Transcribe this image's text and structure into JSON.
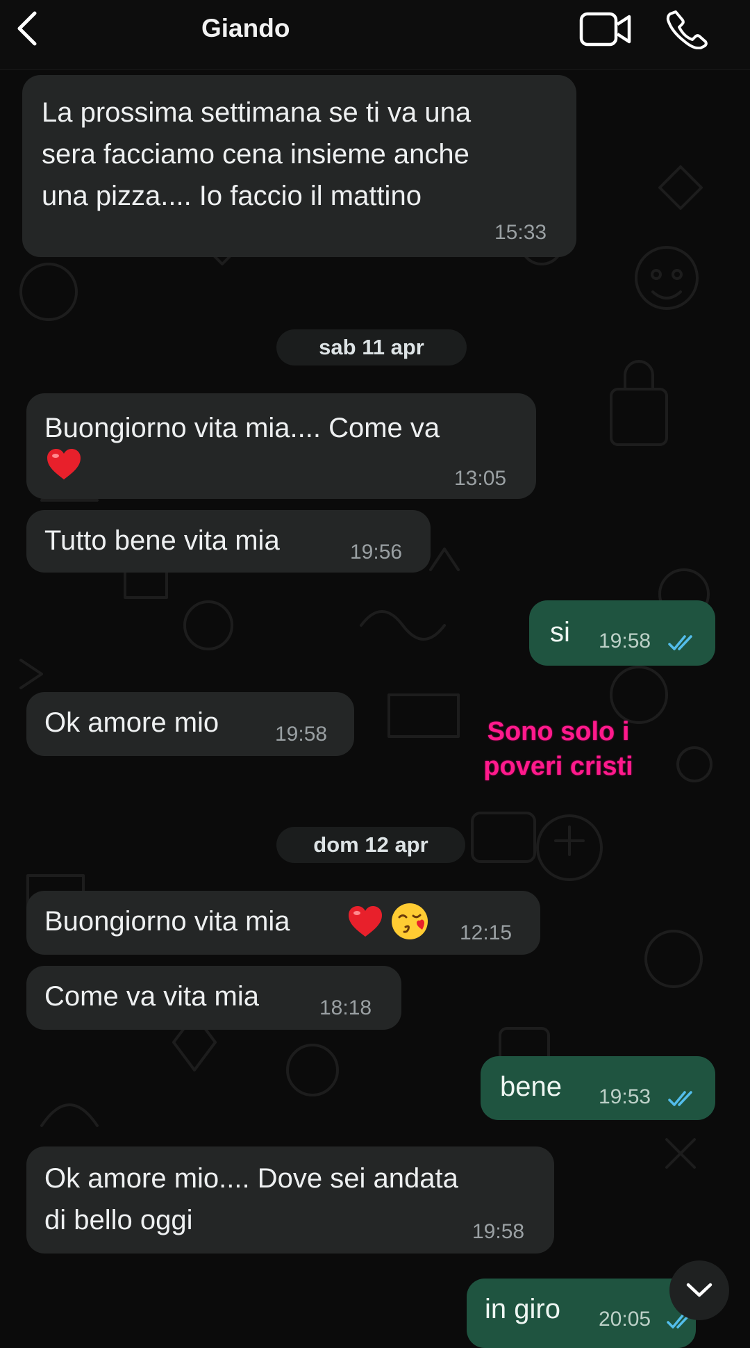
{
  "header": {
    "contact_name": "Giando",
    "back_icon": "chevron-left-icon",
    "video_icon": "video-camera-icon",
    "call_icon": "phone-icon"
  },
  "messages": [
    {
      "dir": "in",
      "lines": [
        "La prossima settimana se ti va una",
        "sera facciamo cena insieme anche",
        "una pizza.... Io faccio il mattino"
      ],
      "time": "15:33"
    },
    {
      "dir": "in",
      "lines": [
        "Buongiorno vita mia.... Come va",
        ""
      ],
      "emoji": "red-heart",
      "time": "13:05"
    },
    {
      "dir": "in",
      "lines": [
        "Tutto bene vita mia"
      ],
      "time": "19:56"
    },
    {
      "dir": "out",
      "lines": [
        "si"
      ],
      "time": "19:58",
      "status": "read"
    },
    {
      "dir": "in",
      "lines": [
        "Ok amore mio"
      ],
      "time": "19:58"
    },
    {
      "dir": "in",
      "lines": [
        "Buongiorno vita mia"
      ],
      "emoji": "red-heart, face-blowing-kiss",
      "time": "12:15"
    },
    {
      "dir": "in",
      "lines": [
        "Come va vita mia"
      ],
      "time": "18:18"
    },
    {
      "dir": "out",
      "lines": [
        "bene"
      ],
      "time": "19:53",
      "status": "read"
    },
    {
      "dir": "in",
      "lines": [
        "Ok amore mio.... Dove sei andata",
        "di bello oggi"
      ],
      "time": "19:58"
    },
    {
      "dir": "out",
      "lines": [
        "in giro"
      ],
      "time": "20:05",
      "status": "read"
    }
  ],
  "dates": [
    "sab 11 apr",
    "dom 12 apr"
  ],
  "sticker": {
    "lines": [
      "Sono solo i",
      "poveri cristi"
    ],
    "color": "#ff1a8c"
  },
  "colors": {
    "incoming": "#242626",
    "outgoing": "#1f5440",
    "read_ticks": "#53bdeb",
    "background": "#0b0b0b"
  },
  "scroll_button_icon": "chevron-down-icon"
}
